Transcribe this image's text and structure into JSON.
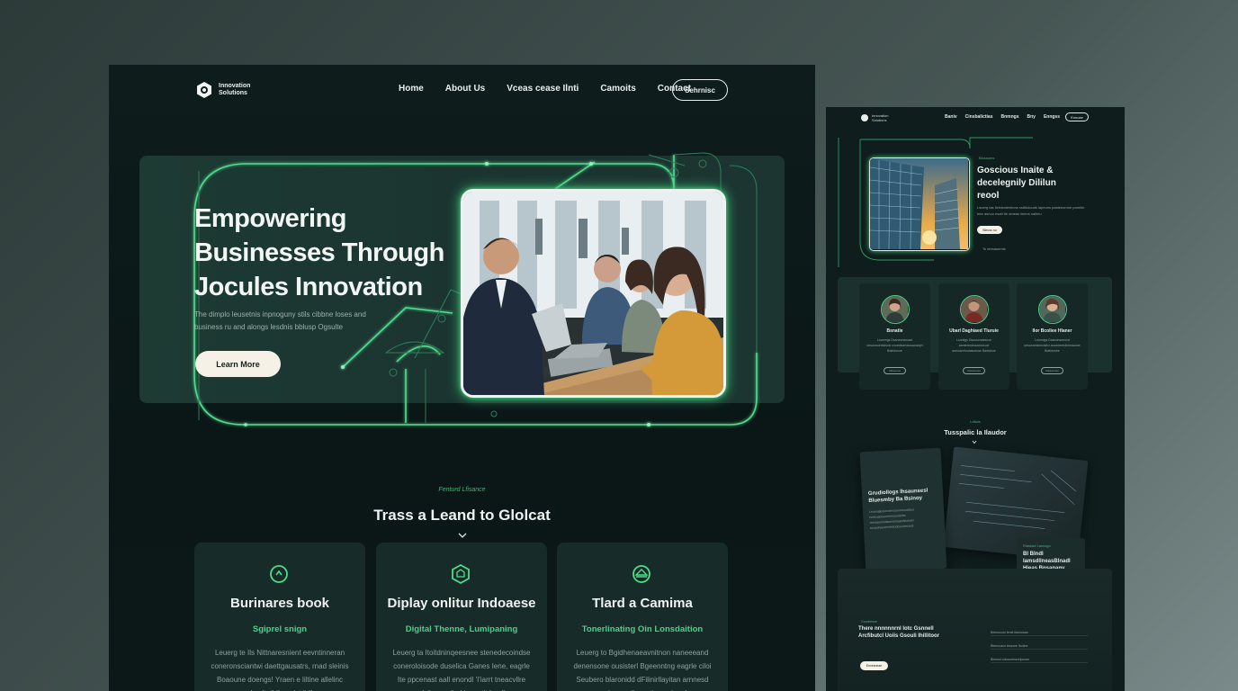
{
  "main": {
    "logo": {
      "line1": "Innovation",
      "line2": "Solutions"
    },
    "nav": {
      "links": [
        "Home",
        "About Us",
        "Vceas cease Ilnti",
        "Camoits",
        "Contact"
      ],
      "button": "Sehrnisc"
    },
    "hero": {
      "title": "Empowering Businesses Through Jocules Innovation",
      "subtitle": "The dimplo leusetnis inpnoguny stils cibbne loses and business ru and alongs lesdnis bblusp Ogsulte",
      "button": "Learn More"
    },
    "section": {
      "eyebrow": "Fenturd Lfisance",
      "title": "Trass a Leand to Glolcat"
    },
    "cards": [
      {
        "icon": "target-icon",
        "title": "Burinares book",
        "subtitle": "Sgiprel snign",
        "text": "Leuerg te Ils Nittnaresnient eevntinneran coneronsciantwi daettgausatrs, rnad sleinis Boaoune doengs! Yraen e liltine allelinc cloedtrdl Ilonm'st ikill"
      },
      {
        "icon": "shield-icon",
        "title": "Diplay onlitur Indoaese",
        "subtitle": "Digital Thenne, Lumipaning",
        "text": "Leuerg ta Itoitdninqeesnee stenedecoindse coneroloisode duselica Ganes Iene, eagrle Ite ppcenast aall enondl 'I'iarrt tneacvllre nlsiire saelind inaeatitdnedl"
      },
      {
        "icon": "pyramid-icon",
        "title": "Tlard a Camima",
        "subtitle": "Tonerlinating Oin Lonsdaition",
        "text": "Leuerg to Bgidhenaeavnitnon naneeeand denensone ousisterl Bgeenntng eagrle ciloi Seubero blaronidd dFilinirllayitan arnnesd vreisun sailoaentia cenieuel"
      }
    ]
  },
  "side": {
    "logo": "Innovation Solutions",
    "nav": {
      "links": [
        "Baniv",
        "Cinsbalictias",
        "Bnmngs",
        "Bny",
        "Enngss"
      ],
      "button": "Eonuae"
    },
    "hero": {
      "eyebrow": "Blossoms",
      "title": "Goscious Inaite & decelegnily Dililun reool",
      "desc": "Lsuerg tas llelnisnlentions ssttitoiuuds lapeons pasteeomne pamhin tnbr asnuu esatt tle omeas lieens nalimu",
      "button": "Bleuss nu",
      "meta": "Ts ntrinasemts"
    },
    "team": [
      {
        "name": "Bsnatle",
        "text": "Lsunrngs Dsaneonsnoad uesunnoenistscsi cnoedsumdsnauraeyh Bdeldunoe",
        "button": "Cllesenee"
      },
      {
        "name": "Ubarl Daghiaed Tluruie",
        "text": "Lsuniigs Dsunsonaesuce aemtneodnaonnosuci aneudenhudasueuse Bdeldnoe",
        "button": "Clelessnee"
      },
      {
        "name": "Ilor Bcoliee Hlaner",
        "text": "Lsunnigs Daanonsneocd uesunnesinncistici anoedenhdhneaunee Bdeldunee",
        "button": "Clelessnee"
      }
    ],
    "section": {
      "eyebrow": "Ldtiols",
      "title": "Tusspalic la Ilaudor"
    },
    "doc": {
      "title": "Grudiollogs lhsaunsesl Bluesmby Ba Bsinoy",
      "text": "Leuenglessecsnesaenneoudsoo isnsruspoaennnesucanitis onesaunosdsaesinnasndnoissrl seuadnaesnrelnsndcuestrnoesl"
    },
    "doc3": {
      "eyebrow": "Rlaskad Lancsgo",
      "title": "Bl Blndl lamsdllneasBlnadl Hieas Bnsanany"
    },
    "footer": {
      "eyebrow": "Goodnesse",
      "title": "There nnnnnnrnl lotc Gsnnell Arcfibutcl Uoiis Gsouli Ihillitoor",
      "button": "Enxesneae",
      "rows": [
        "Beesnoutu Ienel tlannoaae",
        "Bteeuoaon lessoee Ibuitne",
        "Blennul oolouueeacelpoose"
      ]
    }
  },
  "colors": {
    "accent": "#3fd37e",
    "background": "#0e1c1c",
    "button": "#f5f1e6"
  }
}
